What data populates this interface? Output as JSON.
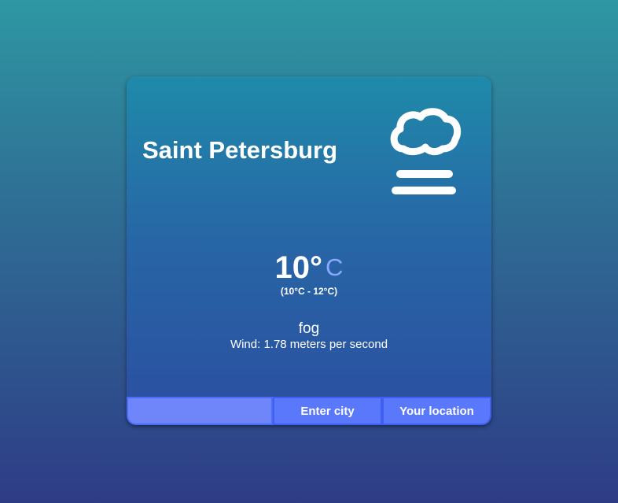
{
  "city": "Saint Petersburg",
  "weather": {
    "icon": "fog-icon",
    "temperature": "10°",
    "unit": "C",
    "range": "(10°C - 12°C)",
    "description": "fog",
    "wind": "Wind: 1.78 meters per second"
  },
  "controls": {
    "city_input_value": "",
    "enter_city_label": "Enter city",
    "your_location_label": "Your location"
  },
  "colors": {
    "unit_accent": "#8aa8ff",
    "button": "#5a78fb",
    "input": "#6f86fb"
  }
}
